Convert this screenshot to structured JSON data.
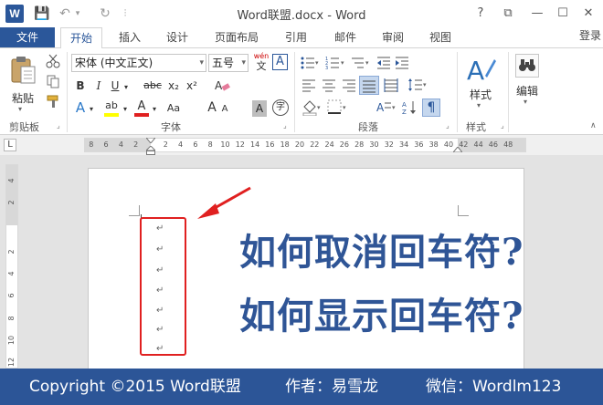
{
  "app": {
    "logo": "W",
    "doc_title": "Word联盟.docx - Word",
    "help": "?",
    "restore": "⧉",
    "minimize": "—",
    "maximize": "☐",
    "close": "✕",
    "login": "登录"
  },
  "quick_access": {
    "save": "💾",
    "undo": "↶",
    "undo_arrow": "▾",
    "redo": "↻",
    "customize": "⫶"
  },
  "tabs": [
    "文件",
    "开始",
    "插入",
    "设计",
    "页面布局",
    "引用",
    "邮件",
    "审阅",
    "视图"
  ],
  "active_tab": "开始",
  "ribbon": {
    "clipboard": {
      "label": "剪贴板",
      "paste": "粘贴"
    },
    "font": {
      "label": "字体",
      "family": "宋体 (中文正文)",
      "size": "五号",
      "wen": "wén",
      "A_box": "A",
      "bold": "B",
      "italic": "I",
      "underline": "U",
      "strike": "abc",
      "sub": "x₂",
      "sup": "x²",
      "grow": "A",
      "shrink": "A",
      "aa": "Aa",
      "clear": "A",
      "char_shade": "A",
      "enclose": "字"
    },
    "paragraph": {
      "label": "段落"
    },
    "styles": {
      "label": "样式",
      "button": "样式"
    },
    "editing": {
      "button": "编辑"
    }
  },
  "ruler": {
    "ticks_left": [
      "8",
      "6",
      "4",
      "2"
    ],
    "ticks_right": [
      "2",
      "4",
      "6",
      "8",
      "10",
      "12",
      "14",
      "16",
      "18",
      "20",
      "22",
      "24",
      "26",
      "28",
      "30",
      "32",
      "34",
      "36",
      "38",
      "40",
      "42",
      "44",
      "46",
      "48"
    ],
    "vticks": [
      "4",
      "2",
      "2",
      "4",
      "6",
      "8",
      "10",
      "12"
    ],
    "corner": "L"
  },
  "document": {
    "paragraph_marks": [
      "↵",
      "↵",
      "↵",
      "↵",
      "↵",
      "↵",
      "↵"
    ],
    "line1": "如何取消回车符?",
    "line2": "如何显示回车符?"
  },
  "footer": {
    "copyright": "Copyright ©2015  Word联盟",
    "author": "作者：易雪龙",
    "wechat": "微信：Wordlm123"
  },
  "colors": {
    "word_blue": "#2b579a",
    "footer_blue": "#2c5597",
    "highlight_red": "#e02020",
    "heading_blue": "#2f5596"
  }
}
